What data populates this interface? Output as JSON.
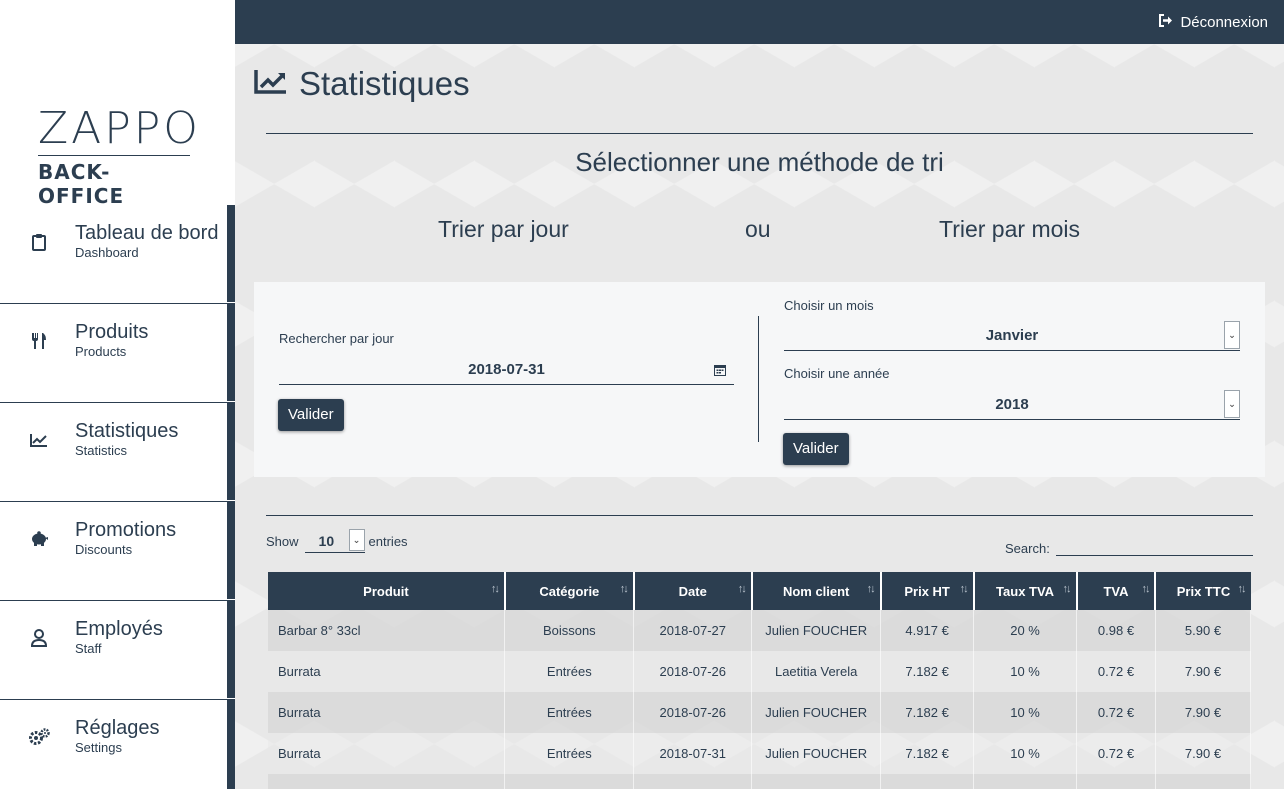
{
  "logo": {
    "top": "ZAPPO",
    "bottom": "BACK-OFFICE"
  },
  "sidebar": {
    "items": [
      {
        "title": "Tableau de bord",
        "sub": "Dashboard",
        "icon": "clipboard-icon"
      },
      {
        "title": "Produits",
        "sub": "Products",
        "icon": "utensils-icon"
      },
      {
        "title": "Statistiques",
        "sub": "Statistics",
        "icon": "chart-line-icon"
      },
      {
        "title": "Promotions",
        "sub": "Discounts",
        "icon": "piggy-bank-icon"
      },
      {
        "title": "Employés",
        "sub": "Staff",
        "icon": "user-icon"
      },
      {
        "title": "Réglages",
        "sub": "Settings",
        "icon": "cogs-icon"
      }
    ]
  },
  "topbar": {
    "logout_label": "Déconnexion"
  },
  "page": {
    "title": "Statistiques"
  },
  "sort": {
    "heading": "Sélectionner une méthode de tri",
    "by_day": "Trier par jour",
    "or": "ou",
    "by_month": "Trier par mois"
  },
  "filters": {
    "day_label": "Rechercher par jour",
    "day_value": "2018-07-31",
    "day_submit": "Valider",
    "month_label": "Choisir un mois",
    "month_value": "Janvier",
    "year_label": "Choisir une année",
    "year_value": "2018",
    "month_submit": "Valider"
  },
  "table_controls": {
    "show_label": "Show",
    "entries_value": "10",
    "entries_label": "entries",
    "search_label": "Search:"
  },
  "table": {
    "headers": [
      "Produit",
      "Catégorie",
      "Date",
      "Nom client",
      "Prix HT",
      "Taux TVA",
      "TVA",
      "Prix TTC"
    ],
    "rows": [
      [
        "Barbar 8° 33cl",
        "Boissons",
        "2018-07-27",
        "Julien FOUCHER",
        "4.917 €",
        "20 %",
        "0.98 €",
        "5.90 €"
      ],
      [
        "Burrata",
        "Entrées",
        "2018-07-26",
        "Laetitia Verela",
        "7.182 €",
        "10 %",
        "0.72 €",
        "7.90 €"
      ],
      [
        "Burrata",
        "Entrées",
        "2018-07-26",
        "Julien FOUCHER",
        "7.182 €",
        "10 %",
        "0.72 €",
        "7.90 €"
      ],
      [
        "Burrata",
        "Entrées",
        "2018-07-31",
        "Julien FOUCHER",
        "7.182 €",
        "10 %",
        "0.72 €",
        "7.90 €"
      ]
    ]
  },
  "colors": {
    "primary": "#2c3e50",
    "panel": "#f6f7f8",
    "background": "#e8e8e8"
  }
}
